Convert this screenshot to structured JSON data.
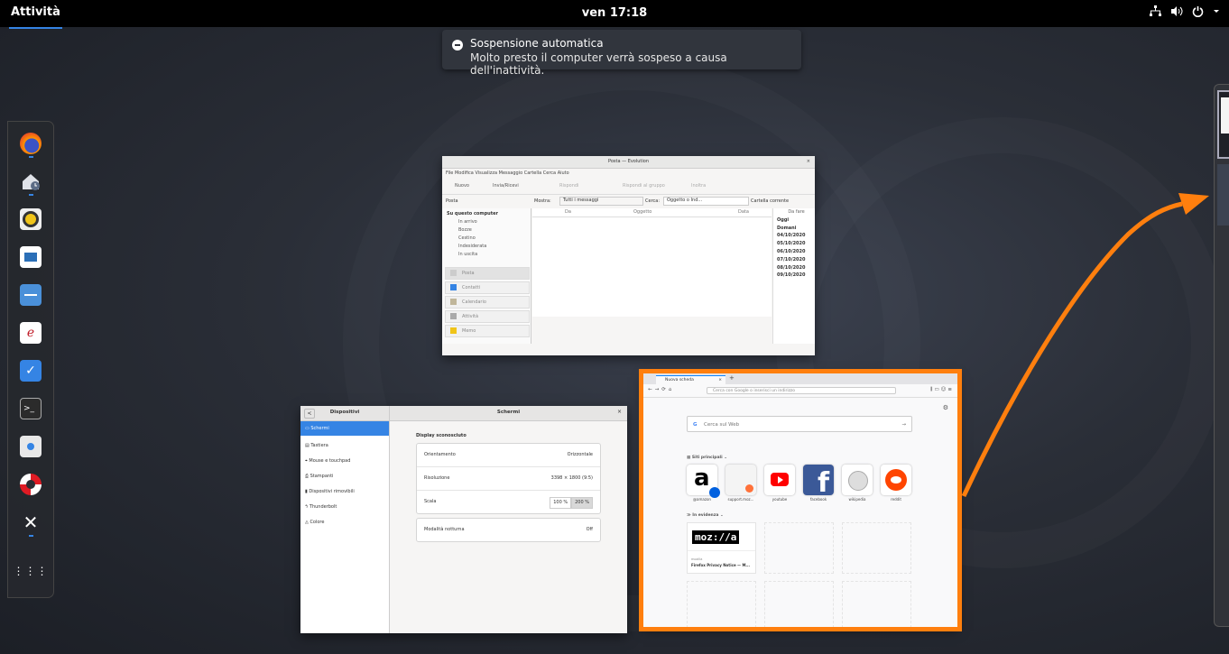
{
  "topbar": {
    "activities": "Attività",
    "clock": "ven 17:18",
    "status_icons": [
      "network-icon",
      "volume-icon",
      "power-icon",
      "chevron-down-icon"
    ]
  },
  "notification": {
    "title": "Sospensione automatica",
    "body": "Molto presto il computer verrà sospeso a causa dell'inattività."
  },
  "dash": {
    "apps": [
      "firefox",
      "evolution",
      "rhythmbox",
      "libreoffice-writer",
      "files",
      "evince",
      "tasks",
      "terminal",
      "software",
      "help",
      "settings",
      "show-apps"
    ]
  },
  "evolution": {
    "title": "Posta — Evolution",
    "menu": "File  Modifica  Visualizza  Messaggio  Cartella  Cerca  Aiuto",
    "toolbar": {
      "nuovo": "Nuovo",
      "invia": "Invia/Ricevi",
      "rispondi": "Rispondi",
      "rispondi_gruppo": "Rispondi al gruppo",
      "inoltra": "Inoltra"
    },
    "filter_bar": {
      "section": "Posta",
      "mostra": "Mostra:",
      "mostra_value": "Tutti i messaggi",
      "cerca": "Cerca:",
      "cerca_value": "Oggetto o Ind...",
      "in": "in",
      "scope": "Cartella corrente"
    },
    "account": "Su questo computer",
    "folders": [
      "In arrivo",
      "Bozze",
      "Cestino",
      "Indesiderata",
      "In uscita"
    ],
    "columns": {
      "da": "Da",
      "oggetto": "Oggetto",
      "data": "Data"
    },
    "sections": [
      "Posta",
      "Contatti",
      "Calendario",
      "Attività",
      "Memo"
    ],
    "todo": {
      "header": "Da fare",
      "items": [
        "Oggi",
        "Domani",
        "04/10/2020",
        "05/10/2020",
        "06/10/2020",
        "07/10/2020",
        "08/10/2020",
        "09/10/2020"
      ]
    }
  },
  "settings": {
    "left_title": "Dispositivi",
    "right_title": "Schermi",
    "items": [
      "Schermi",
      "Tastiera",
      "Mouse e touchpad",
      "Stampanti",
      "Dispositivi rimovibili",
      "Thunderbolt",
      "Colore"
    ],
    "display_heading": "Display sconosciuto",
    "rows": [
      {
        "label": "Orientamento",
        "value": "Orizzontale"
      },
      {
        "label": "Risoluzione",
        "value": "3398 × 1800 (9:5)"
      },
      {
        "label": "Scala",
        "opt1": "100 %",
        "opt2": "200 %"
      }
    ],
    "night": {
      "label": "Modalità notturna",
      "value": "Off"
    }
  },
  "firefox": {
    "tab": "Nuova scheda",
    "url_placeholder": "Cerca con Google o inserisci un indirizzo",
    "search_placeholder": "Cerca sul Web",
    "top_sites_label": "Siti principali",
    "sites": [
      "@amazon",
      "support.moz...",
      "youtube",
      "facebook",
      "wikipedia",
      "reddit"
    ],
    "highlights_label": "In evidenza",
    "highlight_card": {
      "source": "mozilla",
      "title": "Firefox Privacy Notice — M..."
    },
    "highlight_color": "#ff7f0e"
  }
}
